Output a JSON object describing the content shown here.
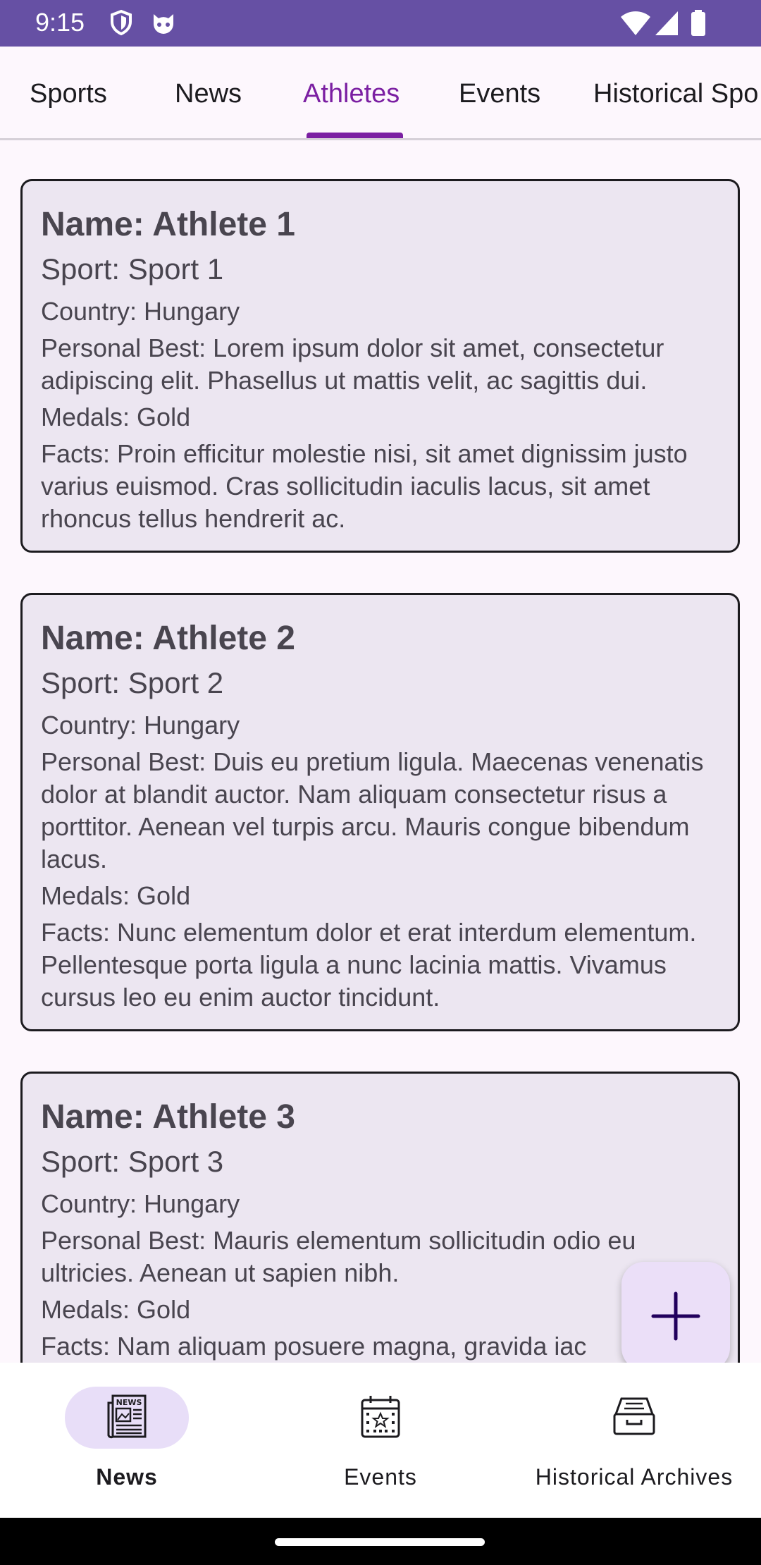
{
  "status_bar": {
    "time": "9:15",
    "icons_left": [
      "shield-icon",
      "cat-face-icon"
    ],
    "icons_right": [
      "wifi-icon",
      "signal-icon",
      "battery-icon"
    ]
  },
  "top_tabs": [
    {
      "label": "Sports",
      "active": false
    },
    {
      "label": "News",
      "active": false
    },
    {
      "label": "Athletes",
      "active": true
    },
    {
      "label": "Events",
      "active": false
    },
    {
      "label": "Historical Spo",
      "active": false
    }
  ],
  "athletes": [
    {
      "name": "Name: Athlete 1",
      "sport": "Sport: Sport 1",
      "country": "Country: Hungary",
      "personal_best": "Personal Best: Lorem ipsum dolor sit amet, consectetur adipiscing elit. Phasellus ut mattis velit, ac sagittis dui.",
      "medals": "Medals: Gold",
      "facts": "Facts: Proin efficitur molestie nisi, sit amet dignissim justo varius euismod. Cras sollicitudin iaculis lacus, sit amet rhoncus tellus hendrerit ac."
    },
    {
      "name": "Name: Athlete 2",
      "sport": "Sport: Sport 2",
      "country": "Country: Hungary",
      "personal_best": "Personal Best: Duis eu pretium ligula. Maecenas venenatis dolor at blandit auctor. Nam aliquam consectetur risus a porttitor. Aenean vel turpis arcu. Mauris congue bibendum lacus.",
      "medals": "Medals: Gold",
      "facts": "Facts: Nunc elementum dolor et erat interdum elementum. Pellentesque porta ligula a nunc lacinia mattis. Vivamus cursus leo eu enim auctor tincidunt."
    },
    {
      "name": "Name: Athlete 3",
      "sport": "Sport: Sport 3",
      "country": "Country: Hungary",
      "personal_best": "Personal Best: Mauris elementum sollicitudin odio eu ultricies. Aenean ut sapien nibh.",
      "medals": "Medals: Gold",
      "facts": "Facts: Nam aliquam posuere magna, gravida iac"
    }
  ],
  "fab": {
    "icon": "plus-icon"
  },
  "bottom_nav": [
    {
      "label": "News",
      "icon": "newspaper-icon",
      "selected": true
    },
    {
      "label": "Events",
      "icon": "calendar-icon",
      "selected": false
    },
    {
      "label": "Historical Archives",
      "icon": "archive-box-icon",
      "selected": false
    }
  ],
  "colors": {
    "status_bar": "#6650a4",
    "accent": "#7b1fa2",
    "card_bg": "#ece6f1",
    "fab_bg": "#ebdff8",
    "nav_pill": "#e8def8"
  }
}
